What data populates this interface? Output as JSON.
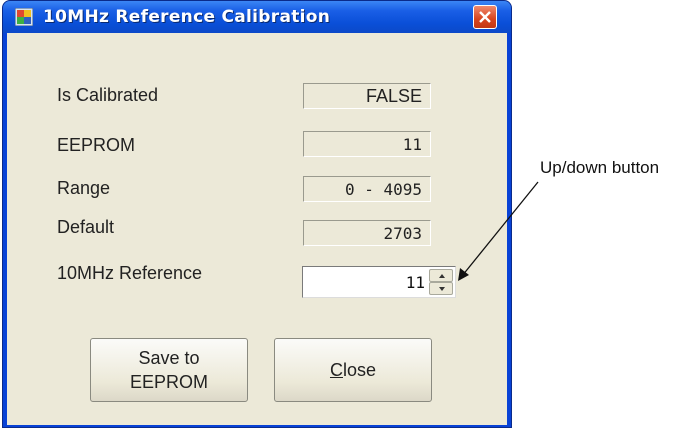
{
  "window": {
    "title": "10MHz Reference Calibration",
    "close_glyph": "✕",
    "app_icon": "calibration-app-icon"
  },
  "fields": {
    "is_calibrated": {
      "label": "Is Calibrated",
      "value": "FALSE"
    },
    "eeprom": {
      "label": "EEPROM",
      "value": "11"
    },
    "range": {
      "label": "Range",
      "value": "0 - 4095"
    },
    "default": {
      "label": "Default",
      "value": "2703"
    }
  },
  "reference": {
    "label": "10MHz Reference",
    "value": "11"
  },
  "buttons": {
    "save_line1": "Save to",
    "save_line2": "EEPROM",
    "close": "Close"
  },
  "annotation": {
    "text": "Up/down button"
  }
}
